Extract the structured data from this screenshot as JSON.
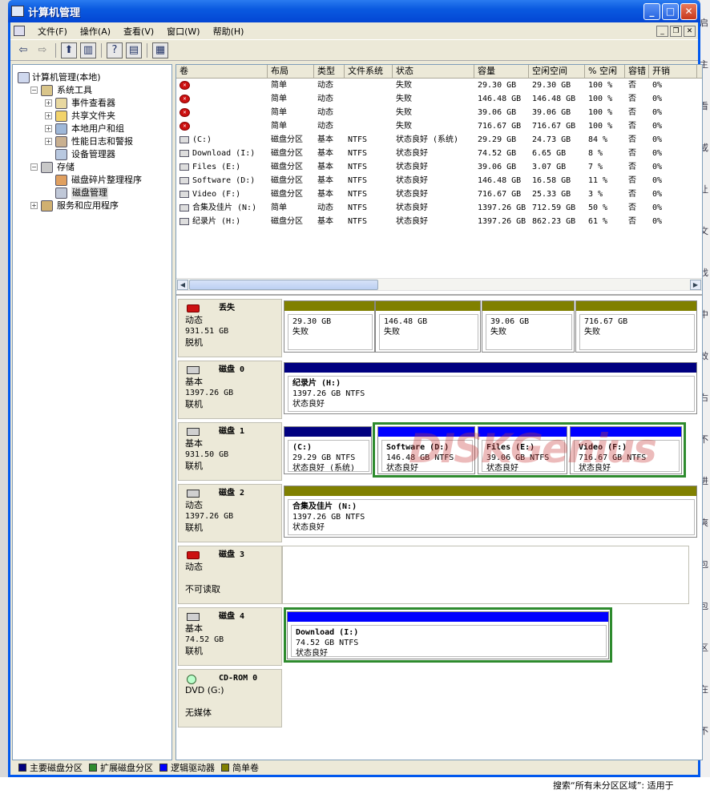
{
  "window": {
    "title": "计算机管理"
  },
  "menu": [
    "文件(F)",
    "操作(A)",
    "查看(V)",
    "窗口(W)",
    "帮助(H)"
  ],
  "tree": [
    {
      "label": "计算机管理(本地)",
      "depth": 0,
      "exp": "",
      "icon": "computer-icon"
    },
    {
      "label": "系统工具",
      "depth": 1,
      "exp": "−",
      "icon": "tools-icon"
    },
    {
      "label": "事件查看器",
      "depth": 2,
      "exp": "+",
      "icon": "event-viewer-icon"
    },
    {
      "label": "共享文件夹",
      "depth": 2,
      "exp": "+",
      "icon": "shared-folder-icon"
    },
    {
      "label": "本地用户和组",
      "depth": 2,
      "exp": "+",
      "icon": "users-icon"
    },
    {
      "label": "性能日志和警报",
      "depth": 2,
      "exp": "+",
      "icon": "performance-icon"
    },
    {
      "label": "设备管理器",
      "depth": 2,
      "exp": "",
      "icon": "device-manager-icon"
    },
    {
      "label": "存储",
      "depth": 1,
      "exp": "−",
      "icon": "storage-icon"
    },
    {
      "label": "磁盘碎片整理程序",
      "depth": 2,
      "exp": "",
      "icon": "defrag-icon"
    },
    {
      "label": "磁盘管理",
      "depth": 2,
      "exp": "",
      "icon": "disk-management-icon",
      "selected": true
    },
    {
      "label": "服务和应用程序",
      "depth": 1,
      "exp": "+",
      "icon": "services-icon"
    }
  ],
  "columns": [
    "卷",
    "布局",
    "类型",
    "文件系统",
    "状态",
    "容量",
    "空闲空间",
    "% 空闲",
    "容错",
    "开销"
  ],
  "volumes": [
    {
      "icon": "fail",
      "cells": [
        "",
        "简单",
        "动态",
        "",
        "失败",
        "29.30 GB",
        "29.30 GB",
        "100 %",
        "否",
        "0%"
      ]
    },
    {
      "icon": "fail",
      "cells": [
        "",
        "简单",
        "动态",
        "",
        "失败",
        "146.48 GB",
        "146.48 GB",
        "100 %",
        "否",
        "0%"
      ]
    },
    {
      "icon": "fail",
      "cells": [
        "",
        "简单",
        "动态",
        "",
        "失败",
        "39.06 GB",
        "39.06 GB",
        "100 %",
        "否",
        "0%"
      ]
    },
    {
      "icon": "fail",
      "cells": [
        "",
        "简单",
        "动态",
        "",
        "失败",
        "716.67 GB",
        "716.67 GB",
        "100 %",
        "否",
        "0%"
      ]
    },
    {
      "icon": "ok",
      "cells": [
        "(C:)",
        "磁盘分区",
        "基本",
        "NTFS",
        "状态良好 (系统)",
        "29.29 GB",
        "24.73 GB",
        "84 %",
        "否",
        "0%"
      ]
    },
    {
      "icon": "ok",
      "cells": [
        "Download (I:)",
        "磁盘分区",
        "基本",
        "NTFS",
        "状态良好",
        "74.52 GB",
        "6.65 GB",
        "8 %",
        "否",
        "0%"
      ]
    },
    {
      "icon": "ok",
      "cells": [
        "Files (E:)",
        "磁盘分区",
        "基本",
        "NTFS",
        "状态良好",
        "39.06 GB",
        "3.07 GB",
        "7 %",
        "否",
        "0%"
      ]
    },
    {
      "icon": "ok",
      "cells": [
        "Software (D:)",
        "磁盘分区",
        "基本",
        "NTFS",
        "状态良好",
        "146.48 GB",
        "16.58 GB",
        "11 %",
        "否",
        "0%"
      ]
    },
    {
      "icon": "ok",
      "cells": [
        "Video (F:)",
        "磁盘分区",
        "基本",
        "NTFS",
        "状态良好",
        "716.67 GB",
        "25.33 GB",
        "3 %",
        "否",
        "0%"
      ]
    },
    {
      "icon": "ok",
      "cells": [
        "合集及佳片 (N:)",
        "简单",
        "动态",
        "NTFS",
        "状态良好",
        "1397.26 GB",
        "712.59 GB",
        "50 %",
        "否",
        "0%"
      ]
    },
    {
      "icon": "ok",
      "cells": [
        "纪录片 (H:)",
        "磁盘分区",
        "基本",
        "NTFS",
        "状态良好",
        "1397.26 GB",
        "862.23 GB",
        "61 %",
        "否",
        "0%"
      ]
    }
  ],
  "disks": [
    {
      "name": "丢失",
      "l1": "动态",
      "l2": "931.51 GB",
      "l3": "脱机",
      "icon": "fail"
    },
    {
      "name": "磁盘 0",
      "l1": "基本",
      "l2": "1397.26 GB",
      "l3": "联机",
      "icon": "disk"
    },
    {
      "name": "磁盘 1",
      "l1": "基本",
      "l2": "931.50 GB",
      "l3": "联机",
      "icon": "disk"
    },
    {
      "name": "磁盘 2",
      "l1": "动态",
      "l2": "1397.26 GB",
      "l3": "联机",
      "icon": "disk"
    },
    {
      "name": "磁盘 3",
      "l1": "动态",
      "l2": "",
      "l3": "不可读取",
      "icon": "fail"
    },
    {
      "name": "磁盘 4",
      "l1": "基本",
      "l2": "74.52 GB",
      "l3": "联机",
      "icon": "disk"
    },
    {
      "name": "CD-ROM 0",
      "l1": "DVD (G:)",
      "l2": "",
      "l3": "无媒体",
      "icon": "cd"
    }
  ],
  "partitions": {
    "missing": [
      {
        "name": "",
        "size": "29.30 GB",
        "status": "失败"
      },
      {
        "name": "",
        "size": "146.48 GB",
        "status": "失败"
      },
      {
        "name": "",
        "size": "39.06 GB",
        "status": "失败"
      },
      {
        "name": "",
        "size": "716.67 GB",
        "status": "失败"
      }
    ],
    "disk0": [
      {
        "name": "纪录片  (H:)",
        "size": "1397.26 GB NTFS",
        "status": "状态良好"
      }
    ],
    "disk1": [
      {
        "name": "(C:)",
        "size": "29.29 GB NTFS",
        "status": "状态良好 (系统)"
      },
      {
        "name": "Software  (D:)",
        "size": "146.48 GB NTFS",
        "status": "状态良好"
      },
      {
        "name": "Files  (E:)",
        "size": "39.06 GB NTFS",
        "status": "状态良好"
      },
      {
        "name": "Video  (F:)",
        "size": "716.67 GB NTFS",
        "status": "状态良好"
      }
    ],
    "disk2": [
      {
        "name": "合集及佳片  (N:)",
        "size": "1397.26 GB NTFS",
        "status": "状态良好"
      }
    ],
    "disk4": [
      {
        "name": "Download  (I:)",
        "size": "74.52 GB NTFS",
        "status": "状态良好"
      }
    ]
  },
  "legend": [
    {
      "label": "主要磁盘分区",
      "color": "#000080"
    },
    {
      "label": "扩展磁盘分区",
      "color": "#2e8b2e"
    },
    {
      "label": "逻辑驱动器",
      "color": "#0000ff"
    },
    {
      "label": "简单卷",
      "color": "#808000"
    }
  ],
  "watermark": "DISKGenius",
  "bg_right": [
    "启",
    "主",
    "看",
    "或",
    "让",
    "文",
    "找",
    "中",
    "效",
    "右",
    "不",
    "进",
    "爽",
    "包",
    "包",
    "区",
    "在",
    "不"
  ],
  "bg_bottom": "搜索“所有未分区区域”: 适用于"
}
